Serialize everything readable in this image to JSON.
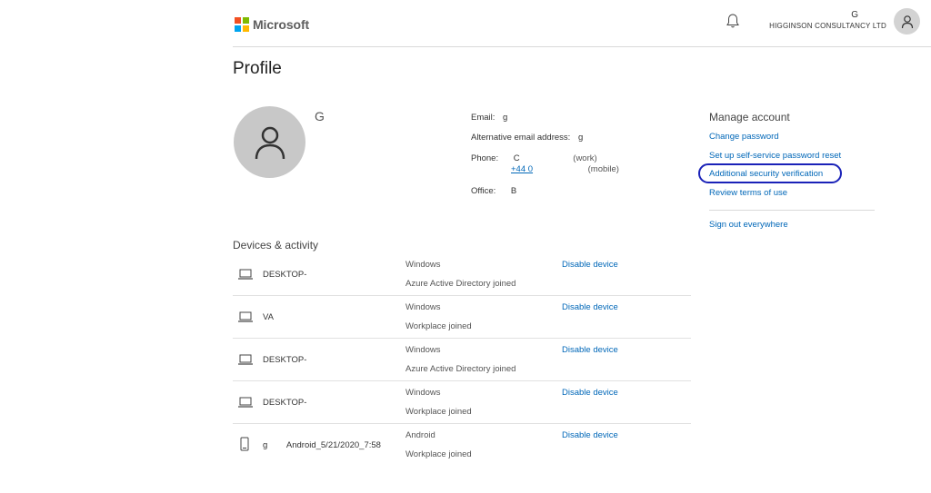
{
  "brand": {
    "name": "Microsoft",
    "colors": [
      "#f25022",
      "#7fba00",
      "#00a4ef",
      "#ffb900"
    ]
  },
  "header": {
    "user_name": "G",
    "organization": "HIGGINSON CONSULTANCY LTD"
  },
  "page": {
    "title": "Profile"
  },
  "profile": {
    "name": "G",
    "email_label": "Email:",
    "email_value": "g",
    "alt_email_label": "Alternative email address:",
    "alt_email_value": "g",
    "phone_label": "Phone:",
    "phone_work_value": "C",
    "phone_work_tag": "(work)",
    "phone_mobile_value": "+44 0",
    "phone_mobile_tag": "(mobile)",
    "office_label": "Office:",
    "office_value": "B"
  },
  "manage": {
    "title": "Manage account",
    "links": [
      "Change password",
      "Set up self-service password reset",
      "Additional security verification",
      "Review terms of use"
    ],
    "sign_out": "Sign out everywhere"
  },
  "devices": {
    "title": "Devices & activity",
    "items": [
      {
        "type": "laptop",
        "name": "DESKTOP-",
        "os": "Windows",
        "join": "Azure Active Directory joined",
        "action": "Disable device"
      },
      {
        "type": "laptop",
        "name": "VA",
        "os": "Windows",
        "join": "Workplace joined",
        "action": "Disable device"
      },
      {
        "type": "laptop",
        "name": "DESKTOP-",
        "os": "Windows",
        "join": "Azure Active Directory joined",
        "action": "Disable device"
      },
      {
        "type": "laptop",
        "name": "DESKTOP-",
        "os": "Windows",
        "join": "Workplace joined",
        "action": "Disable device"
      },
      {
        "type": "phone",
        "name": "g        Android_5/21/2020_7:58",
        "os": "Android",
        "join": "Workplace joined",
        "action": "Disable device"
      }
    ]
  },
  "accent": "#0067b8",
  "annotation_color": "#1a22b8"
}
